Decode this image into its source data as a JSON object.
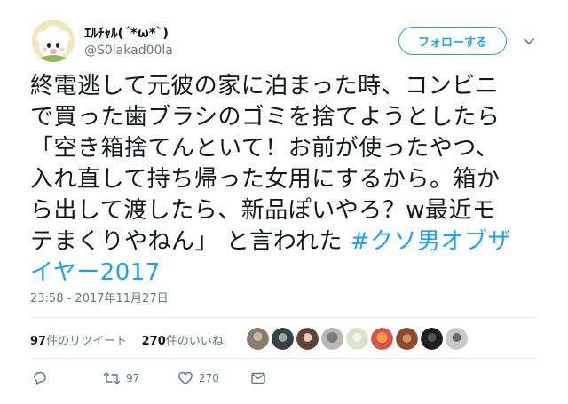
{
  "user": {
    "display_name": "ｴﾙﾁｬﾙ(´*ω*`)",
    "screen_name": "@S0lakad00la"
  },
  "follow_button_label": "フォローする",
  "tweet": {
    "lines": [
      "終電逃して元彼の家に泊まった時、コンビニ",
      "で買った歯ブラシのゴミを捨てようとしたら",
      "「空き箱捨てんといて！お前が使ったやつ、",
      "入れ直して持ち帰った女用にするから。箱か",
      "ら出して渡したら、新品ぽいやろ？w最近モ",
      "テまくりやねん」 と言われた"
    ],
    "hashtag_line1": "#クソ男オブザ",
    "hashtag_line2": "イヤー2017",
    "timestamp": "23:58 - 2017年11月27日"
  },
  "stats": {
    "retweet_count": "97",
    "retweet_label": "件のリツイート",
    "like_count": "270",
    "like_label": "件のいいね"
  },
  "actions": {
    "retweets": "97",
    "likes": "270"
  },
  "colors": {
    "accent": "#1da1f2",
    "secondary_text": "#657786",
    "divider": "#e6ecf0"
  },
  "icons": [
    "reply-icon",
    "retweet-icon",
    "like-icon",
    "message-icon",
    "chevron-down-icon"
  ]
}
